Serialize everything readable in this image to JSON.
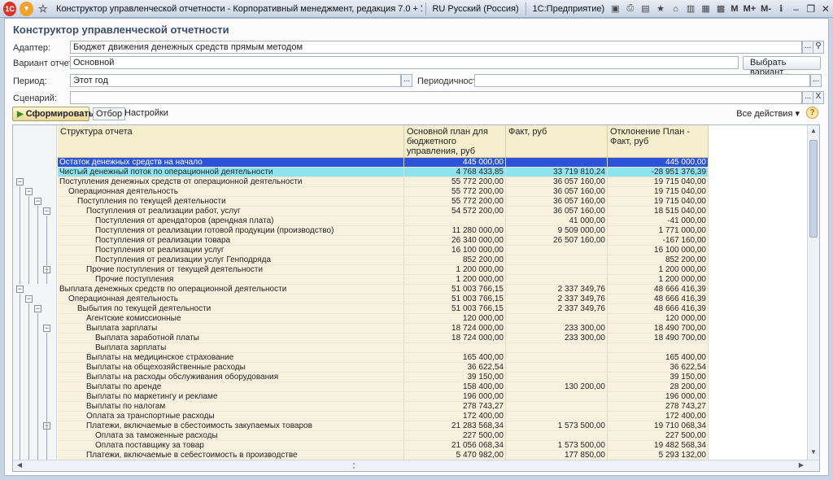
{
  "titlebar": {
    "title": "Конструктор управленческой отчетности - Корпоративный менеджмент, редакция 7.0 + Управление производственным п",
    "language": "RU Русский (Россия)",
    "app": "1С:Предприятие)",
    "m_labels": [
      "M",
      "M+",
      "M-"
    ]
  },
  "form": {
    "title": "Конструктор управленческой отчетности",
    "adapter_label": "Адаптер:",
    "adapter_value": "Бюджет движения денежных средств прямым методом",
    "variant_label": "Вариант отчета:",
    "variant_value": "Основной",
    "choose_variant_button": "Выбрать вариант...",
    "period_label": "Период:",
    "period_value": "Этот год",
    "periodicity_label": "Периодичность:",
    "periodicity_value": "",
    "scenario_label": "Сценарий:",
    "scenario_value": "",
    "dots": "...",
    "clear": "X"
  },
  "toolbar": {
    "run_button": "Сформировать",
    "filter_button": "Отбор",
    "settings_button": "Настройки",
    "all_actions": "Все действия ▾",
    "help": "?"
  },
  "table": {
    "headers": [
      "Структура отчета",
      "Основной план для бюджетного управления, руб",
      "Факт, руб",
      "Отклонение План - Факт, руб"
    ],
    "rows": [
      {
        "name": "Остаток денежных средств на начало",
        "plan": "445 000,00",
        "fact": "",
        "dev": "445 000,00",
        "style": "blue",
        "indent": 0
      },
      {
        "name": "Чистый денежный поток по операционной деятельности",
        "plan": "4 768 433,85",
        "fact": "33 719 810,24",
        "dev": "-28 951 376,39",
        "style": "cyan",
        "indent": 0
      },
      {
        "name": "Поступления денежных средств от операционной деятельности",
        "plan": "55 772 200,00",
        "fact": "36 057 160,00",
        "dev": "19 715 040,00",
        "style": "beige",
        "indent": 0
      },
      {
        "name": "Операционная деятельность",
        "plan": "55 772 200,00",
        "fact": "36 057 160,00",
        "dev": "19 715 040,00",
        "style": "beige",
        "indent": 1
      },
      {
        "name": "Поступления по текущей деятельности",
        "plan": "55 772 200,00",
        "fact": "36 057 160,00",
        "dev": "19 715 040,00",
        "style": "beige",
        "indent": 2
      },
      {
        "name": "Поступления от реализации работ, услуг",
        "plan": "54 572 200,00",
        "fact": "36 057 160,00",
        "dev": "18 515 040,00",
        "style": "beige",
        "indent": 3
      },
      {
        "name": "Поступления от арендаторов (арендная плата)",
        "plan": "",
        "fact": "41 000,00",
        "dev": "-41 000,00",
        "style": "beige",
        "indent": 4
      },
      {
        "name": "Поступления от реализации готовой продукции (производство)",
        "plan": "11 280 000,00",
        "fact": "9 509 000,00",
        "dev": "1 771 000,00",
        "style": "beige",
        "indent": 4
      },
      {
        "name": "Поступления от реализации товара",
        "plan": "26 340 000,00",
        "fact": "26 507 160,00",
        "dev": "-167 160,00",
        "style": "beige",
        "indent": 4
      },
      {
        "name": "Поступления от реализации услуг",
        "plan": "16 100 000,00",
        "fact": "",
        "dev": "16 100 000,00",
        "style": "beige",
        "indent": 4
      },
      {
        "name": "Поступления от реализации услуг Генподряда",
        "plan": "852 200,00",
        "fact": "",
        "dev": "852 200,00",
        "style": "beige",
        "indent": 4
      },
      {
        "name": "Прочие поступления от текущей деятельности",
        "plan": "1 200 000,00",
        "fact": "",
        "dev": "1 200 000,00",
        "style": "beige",
        "indent": 3
      },
      {
        "name": "Прочие поступления",
        "plan": "1 200 000,00",
        "fact": "",
        "dev": "1 200 000,00",
        "style": "beige",
        "indent": 4
      },
      {
        "name": "Выплата денежных средств по операционной деятельности",
        "plan": "51 003 766,15",
        "fact": "2 337 349,76",
        "dev": "48 666 416,39",
        "style": "beige",
        "indent": 0
      },
      {
        "name": "Операционная деятельность",
        "plan": "51 003 766,15",
        "fact": "2 337 349,76",
        "dev": "48 666 416,39",
        "style": "beige",
        "indent": 1
      },
      {
        "name": "Выбытия по текущей деятельности",
        "plan": "51 003 766,15",
        "fact": "2 337 349,76",
        "dev": "48 666 416,39",
        "style": "beige",
        "indent": 2
      },
      {
        "name": "Агентские комиссионные",
        "plan": "120 000,00",
        "fact": "",
        "dev": "120 000,00",
        "style": "beige",
        "indent": 3
      },
      {
        "name": "Выплата зарплаты",
        "plan": "18 724 000,00",
        "fact": "233 300,00",
        "dev": "18 490 700,00",
        "style": "beige",
        "indent": 3
      },
      {
        "name": "Выплата заработной платы",
        "plan": "18 724 000,00",
        "fact": "233 300,00",
        "dev": "18 490 700,00",
        "style": "beige",
        "indent": 4
      },
      {
        "name": "Выплата зарплаты",
        "plan": "",
        "fact": "",
        "dev": "",
        "style": "beige",
        "indent": 4
      },
      {
        "name": "Выплаты на медицинское страхование",
        "plan": "165 400,00",
        "fact": "",
        "dev": "165 400,00",
        "style": "beige",
        "indent": 3
      },
      {
        "name": "Выплаты на общехозяйственные расходы",
        "plan": "36 622,54",
        "fact": "",
        "dev": "36 622,54",
        "style": "beige",
        "indent": 3
      },
      {
        "name": "Выплаты на расходы обслуживания оборудования",
        "plan": "39 150,00",
        "fact": "",
        "dev": "39 150,00",
        "style": "beige",
        "indent": 3
      },
      {
        "name": "Выплаты по аренде",
        "plan": "158 400,00",
        "fact": "130 200,00",
        "dev": "28 200,00",
        "style": "beige",
        "indent": 3
      },
      {
        "name": "Выплаты по маркетингу и рекламе",
        "plan": "196 000,00",
        "fact": "",
        "dev": "196 000,00",
        "style": "beige",
        "indent": 3
      },
      {
        "name": "Выплаты по налогам",
        "plan": "278 743,27",
        "fact": "",
        "dev": "278 743,27",
        "style": "beige",
        "indent": 3
      },
      {
        "name": "Оплата за транспортные расходы",
        "plan": "172 400,00",
        "fact": "",
        "dev": "172 400,00",
        "style": "beige",
        "indent": 3
      },
      {
        "name": "Платежи, включаемые в сбестоимость закупаемых товаров",
        "plan": "21 283 568,34",
        "fact": "1 573 500,00",
        "dev": "19 710 068,34",
        "style": "beige",
        "indent": 3
      },
      {
        "name": "Оплата за таможенные расходы",
        "plan": "227 500,00",
        "fact": "",
        "dev": "227 500,00",
        "style": "beige",
        "indent": 4
      },
      {
        "name": "Оплата поставщику за товар",
        "plan": "21 056 068,34",
        "fact": "1 573 500,00",
        "dev": "19 482 568,34",
        "style": "beige",
        "indent": 4
      },
      {
        "name": "Платежи, включаемые в себестоимость в производстве",
        "plan": "5 470 982,00",
        "fact": "177 850,00",
        "dev": "5 293 132,00",
        "style": "beige",
        "indent": 3
      }
    ]
  }
}
